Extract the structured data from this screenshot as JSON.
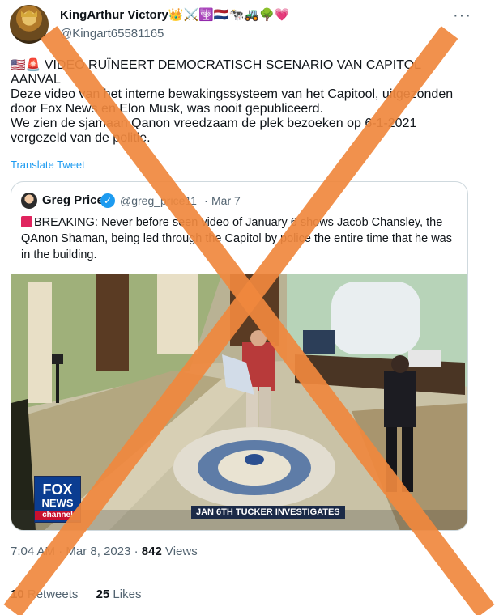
{
  "author": {
    "display_name": "KingArthur Victory",
    "name_emojis": "👑⚔️🕎🇳🇱🐄🚜🌳💗",
    "handle": "@Kingart65581165"
  },
  "tweet": {
    "flags": "🇺🇸🚨",
    "line1": "VIDEO RUÏNEERT DEMOCRATISCH SCENARIO VAN CAPITOL AANVAL",
    "line2": "Deze video van het interne bewakingssysteem van het Capitool, uitgezonden door Fox News en Elon Musk, was nooit gepubliceerd.",
    "line3": "We zien de sjamaan Qanon vreedzaam de plek bezoeken op 6-1-2021 vergezeld van de politie.",
    "translate_label": "Translate Tweet",
    "time": "7:04 AM",
    "date": "Mar 8, 2023",
    "views_count": "842",
    "views_label": "Views",
    "retweets_count": "10",
    "retweets_label": "Retweets",
    "likes_count": "25",
    "likes_label": "Likes"
  },
  "quoted": {
    "name": "Greg Price",
    "handle": "@greg_price11",
    "separator": "·",
    "date": "Mar 7",
    "text": "BREAKING: Never before seen video of January 6 shows Jacob Chansley, the QAnon Shaman, being led through the Capitol by police the entire time that he was in the building.",
    "video": {
      "chyron": "JAN 6TH  TUCKER INVESTIGATES",
      "logo_line1": "FOX",
      "logo_line2": "NEWS",
      "logo_line3": "channel"
    }
  },
  "overlay": {
    "cross_color": "#f0883e"
  },
  "icons": {
    "more": "more-icon",
    "verified": "verified-badge-icon",
    "siren": "siren-icon"
  }
}
